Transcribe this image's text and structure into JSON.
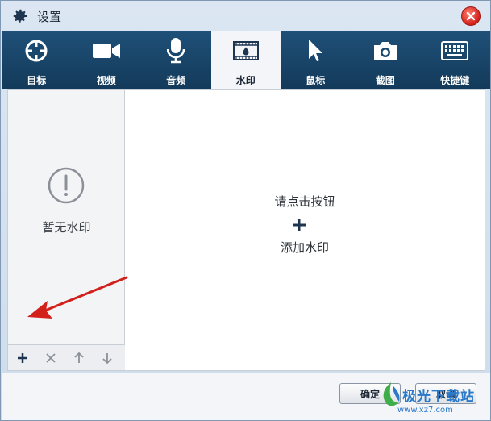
{
  "window": {
    "title": "设置",
    "icon": "gear-icon",
    "close_icon": "close-icon"
  },
  "tabs": [
    {
      "label": "目标",
      "icon": "target-icon",
      "active": false
    },
    {
      "label": "视频",
      "icon": "video-camera-icon",
      "active": false
    },
    {
      "label": "音频",
      "icon": "microphone-icon",
      "active": false
    },
    {
      "label": "水印",
      "icon": "watermark-film-icon",
      "active": true
    },
    {
      "label": "鼠标",
      "icon": "mouse-pointer-icon",
      "active": false
    },
    {
      "label": "截图",
      "icon": "camera-icon",
      "active": false
    },
    {
      "label": "快捷键",
      "icon": "keyboard-icon",
      "active": false
    }
  ],
  "left_panel": {
    "empty_text": "暂无水印",
    "empty_icon": "exclamation-circle-icon",
    "toolbar": [
      {
        "icon": "plus-icon",
        "enabled": true
      },
      {
        "icon": "delete-x-icon",
        "enabled": false
      },
      {
        "icon": "arrow-up-icon",
        "enabled": false
      },
      {
        "icon": "arrow-down-icon",
        "enabled": false
      }
    ]
  },
  "main_panel": {
    "hint_line1": "请点击按钮",
    "add_icon": "plus-icon",
    "hint_line2": "添加水印"
  },
  "footer": {
    "ok_label": "确定",
    "cancel_label": "取消"
  },
  "overlay": {
    "watermark_text": "极光下载站",
    "watermark_url": "www.xz7.com",
    "annotation": "red-arrow"
  },
  "colors": {
    "tab_bar": "#1a476b",
    "active_tab": "#f3f5f8",
    "accent_red": "#d3201a",
    "watermark_blue": "#2b79c9"
  }
}
